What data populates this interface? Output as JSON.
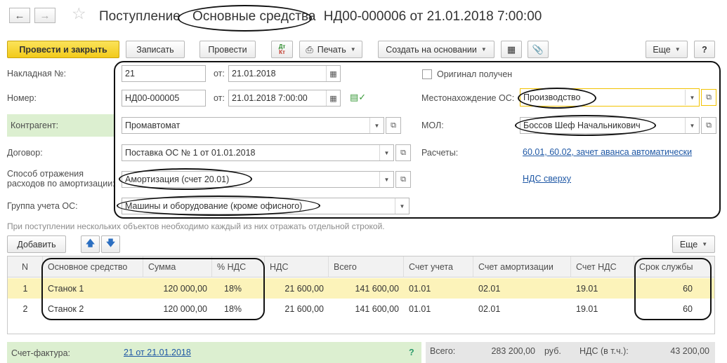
{
  "header": {
    "title_prefix": "Поступление",
    "title_emph": "Основные средства",
    "title_suffix": "НД00-000006 от 21.01.2018 7:00:00"
  },
  "toolbar": {
    "post_and_close": "Провести и закрыть",
    "save": "Записать",
    "post": "Провести",
    "print": "Печать",
    "create_based_on": "Создать на основании",
    "more": "Еще",
    "help": "?"
  },
  "form": {
    "invoice_label": "Накладная №:",
    "invoice_number": "21",
    "invoice_from_label": "от:",
    "invoice_date": "21.01.2018",
    "number_label": "Номер:",
    "number_value": "НД00-000005",
    "number_from_label": "от:",
    "number_date": "21.01.2018  7:00:00",
    "counterparty_label": "Контрагент:",
    "counterparty_value": "Промавтомат",
    "contract_label": "Договор:",
    "contract_value": "Поставка ОС № 1 от 01.01.2018",
    "depreciation_label": "Способ отражения расходов по амортизации:",
    "depreciation_value": "Амортизация (счет 20.01)",
    "group_label": "Группа учета ОС:",
    "group_value": "Машины и оборудование (кроме офисного)",
    "original_received_label": "Оригинал получен",
    "location_label": "Местонахождение ОС:",
    "location_value": "Производство",
    "mol_label": "МОЛ:",
    "mol_value": "Боссов Шеф Начальникович",
    "settlements_label": "Расчеты:",
    "settlements_link": "60.01, 60.02, зачет аванса автоматически",
    "vat_link": "НДС сверху"
  },
  "hint": "При поступлении нескольких объектов необходимо каждый из них отражать отдельной строкой.",
  "table_toolbar": {
    "add": "Добавить",
    "more": "Еще"
  },
  "table": {
    "columns": [
      "N",
      "Основное средство",
      "Сумма",
      "% НДС",
      "НДС",
      "Всего",
      "Счет учета",
      "Счет амортизации",
      "Счет НДС",
      "Срок службы"
    ],
    "rows": [
      {
        "n": "1",
        "asset": "Станок 1",
        "sum": "120 000,00",
        "vat_rate": "18%",
        "vat": "21 600,00",
        "total": "141 600,00",
        "account": "01.01",
        "depr_account": "02.01",
        "vat_account": "19.01",
        "life": "60"
      },
      {
        "n": "2",
        "asset": "Станок 2",
        "sum": "120 000,00",
        "vat_rate": "18%",
        "vat": "21 600,00",
        "total": "141 600,00",
        "account": "01.01",
        "depr_account": "02.01",
        "vat_account": "19.01",
        "life": "60"
      }
    ]
  },
  "footer": {
    "invoice_label": "Счет-фактура:",
    "invoice_link": "21 от 21.01.2018",
    "question": "?",
    "total_label": "Всего:",
    "total_value": "283 200,00",
    "currency": "руб.",
    "vat_label": "НДС (в т.ч.):",
    "vat_value": "43 200,00"
  },
  "colors": {
    "primary_button": "#f2ca1a",
    "selected_row": "#fcf3ba",
    "green_band": "#dcefd0",
    "link": "#1f58a5"
  }
}
